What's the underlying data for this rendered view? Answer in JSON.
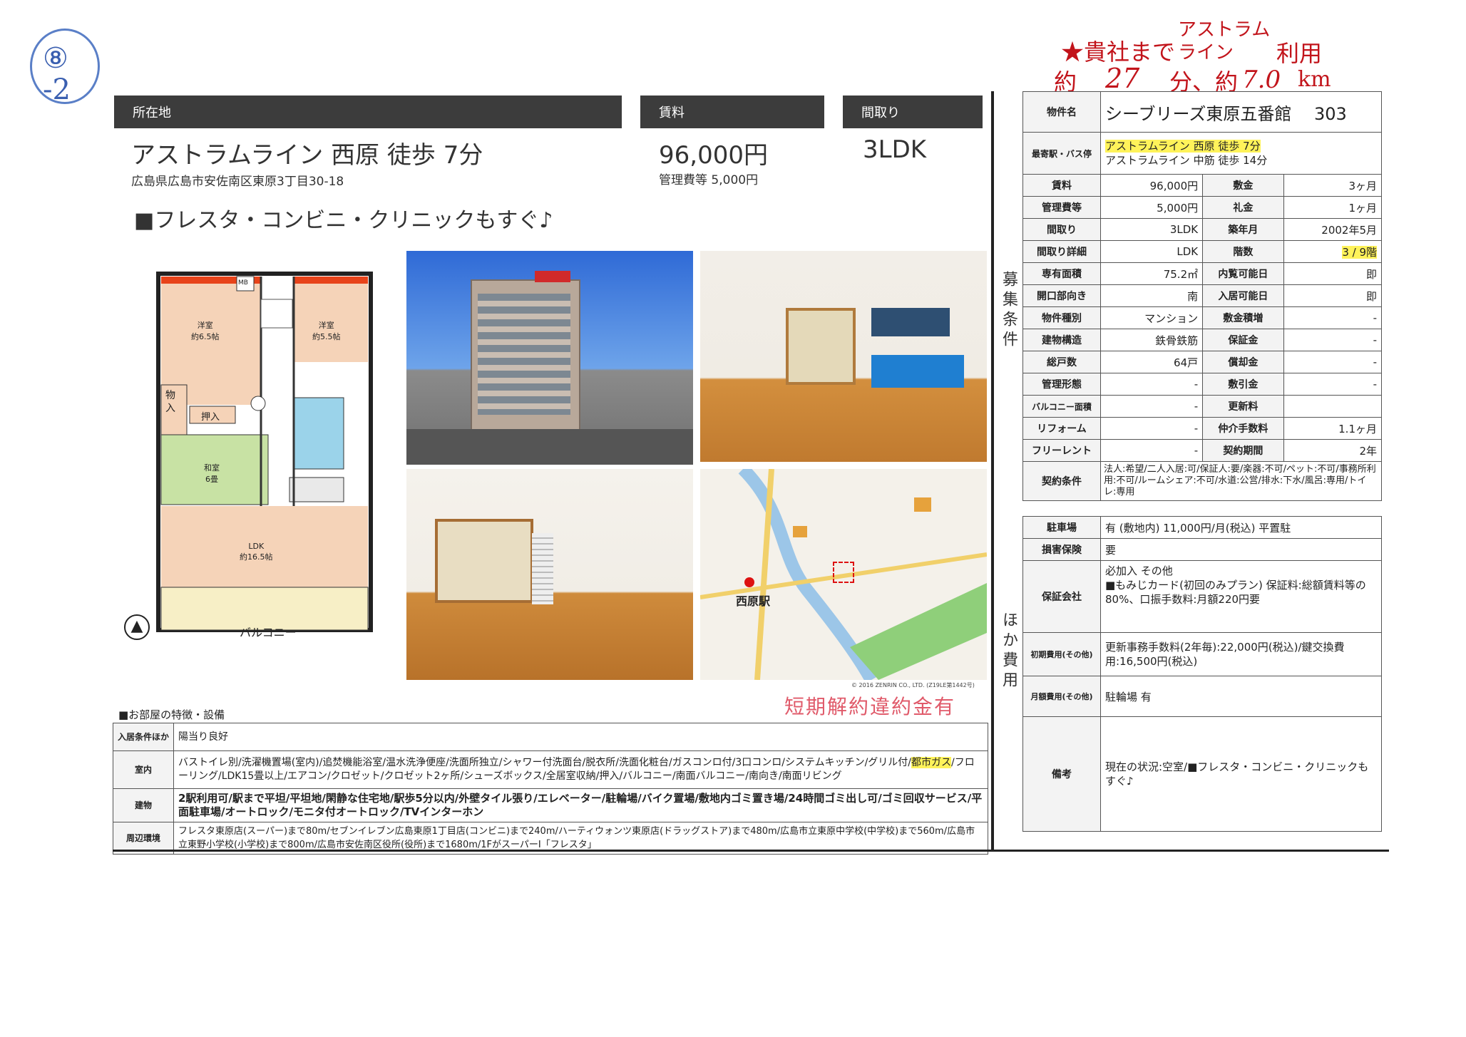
{
  "handwritten": {
    "top_left": "⑧\n-2",
    "line1": "★貴社まで",
    "line1_mid": "アストラム\nライン",
    "line1_end": "利用",
    "line2": "約",
    "line2_b": "27",
    "line2_c": "分、約",
    "line2_d": "7.0",
    "line2_e": "km"
  },
  "header": {
    "location_label": "所在地",
    "rent_label": "賃料",
    "layout_label": "間取り",
    "station": "アストラムライン 西原 徒歩 7分",
    "address": "広島県広島市安佐南区東原3丁目30-18",
    "rent": "96,000円",
    "mgmt": "管理費等 5,000円",
    "layout": "3LDK",
    "catch": "■フレスタ・コンビニ・クリニックもすぐ♪"
  },
  "floorplan": {
    "room1": "洋室\n約6.5帖",
    "room2": "洋室\n約5.5帖",
    "mb": "MB",
    "closet1": "物\n入",
    "closet2": "押入",
    "washitsu": "和室\n6畳",
    "ldk": "LDK\n約16.5帖",
    "balcony": "バルコニー"
  },
  "map": {
    "station": "西原駅",
    "copyright": "© 2016 ZENRIN CO., LTD. (Z19LE第1442号)"
  },
  "stamp": "短期解約違約金有",
  "features": {
    "title": "■お部屋の特徴・設備",
    "rows": [
      {
        "label": "入居条件ほか",
        "value": "陽当り良好"
      },
      {
        "label": "室内",
        "value": "バストイレ別/洗濯機置場(室内)/追焚機能浴室/温水洗浄便座/洗面所独立/シャワー付洗面台/脱衣所/洗面化粧台/ガスコンロ付/3口コンロ/システムキッチン/グリル付/",
        "value_hl": "都市ガス",
        "value2": "/フローリング/LDK15畳以上/エアコン/クロゼット/クロゼット2ヶ所/シューズボックス/全居室収納/押入/バルコニー/南面バルコニー/南向き/南面リビング"
      },
      {
        "label": "建物",
        "value": "2駅利用可/駅まで平坦/平坦地/閑静な住宅地/駅歩5分以内/外壁タイル張り/エレベーター/駐輪場/バイク置場/敷地内ゴミ置き場/24時間ゴミ出し可/ゴミ回収サービス/平面駐車場/オートロック/モニタ付オートロック/TVインターホン"
      },
      {
        "label": "周辺環境",
        "value": "フレスタ東原店(スーパー)まで80m/セブンイレブン広島東原1丁目店(コンビニ)まで240m/ハーティウォンツ東原店(ドラッグストア)まで480m/広島市立東原中学校(中学校)まで560m/広島市立東野小学校(小学校)まで800m/広島市安佐南区役所(役所)まで1680m/1FがスーパーI「フレスタ」"
      }
    ]
  },
  "spec": {
    "name_label": "物件名",
    "name": "シーブリーズ東原五番館　 303",
    "station_label": "最寄駅・バス停",
    "station1": "アストラムライン 西原 徒歩 7分",
    "station2": "アストラムライン 中筋 徒歩 14分",
    "side_recruit": "募集条件",
    "side_other": "ほか費用",
    "rows": [
      {
        "l1": "賃料",
        "v1": "96,000円",
        "l2": "敷金",
        "v2": "3ヶ月"
      },
      {
        "l1": "管理費等",
        "v1": "5,000円",
        "l2": "礼金",
        "v2": "1ヶ月"
      },
      {
        "l1": "間取り",
        "v1": "3LDK",
        "l2": "築年月",
        "v2": "2002年5月"
      },
      {
        "l1": "間取り詳細",
        "v1": "LDK",
        "l2": "階数",
        "v2": "3 / 9階"
      },
      {
        "l1": "専有面積",
        "v1": "75.2㎡",
        "l2": "内覧可能日",
        "v2": "即"
      },
      {
        "l1": "開口部向き",
        "v1": "南",
        "l2": "入居可能日",
        "v2": "即"
      },
      {
        "l1": "物件種別",
        "v1": "マンション",
        "l2": "敷金積増",
        "v2": "-"
      },
      {
        "l1": "建物構造",
        "v1": "鉄骨鉄筋",
        "l2": "保証金",
        "v2": "-"
      },
      {
        "l1": "総戸数",
        "v1": "64戸",
        "l2": "償却金",
        "v2": "-"
      },
      {
        "l1": "管理形態",
        "v1": "-",
        "l2": "敷引金",
        "v2": "-"
      },
      {
        "l1": "バルコニー面積",
        "v1": "-",
        "l2": "更新料",
        "v2": ""
      },
      {
        "l1": "リフォーム",
        "v1": "-",
        "l2": "仲介手数料",
        "v2": "1.1ヶ月"
      },
      {
        "l1": "フリーレント",
        "v1": "-",
        "l2": "契約期間",
        "v2": "2年"
      }
    ],
    "contract_label": "契約条件",
    "contract": "法人:希望/二人入居:可/保証人:要/楽器:不可/ペット:不可/事務所利用:不可/ルームシェア:不可/水道:公営/排水:下水/風呂:専用/トイレ:専用",
    "parking_label": "駐車場",
    "parking": "有 (敷地内) 11,000円/月(税込) 平置駐",
    "insurance_label": "損害保険",
    "insurance": "要",
    "guarantor_label": "保証会社",
    "guarantor": "必加入 その他\n■もみじカード(初回のみプラン) 保証料:総額賃料等の80%、口振手数料:月額220円要",
    "initial_label": "初期費用(その他)",
    "initial": "更新事務手数料(2年毎):22,000円(税込)/鍵交換費用:16,500円(税込)",
    "monthly_label": "月額費用(その他)",
    "monthly": "駐輪場 有",
    "remarks_label": "備考",
    "remarks": "現在の状況:空室/■フレスタ・コンビニ・クリニックもすぐ♪"
  }
}
